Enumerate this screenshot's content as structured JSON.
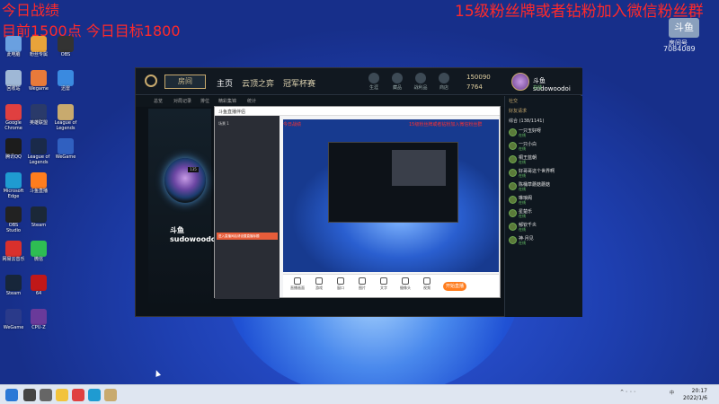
{
  "overlay": {
    "left_line1": "今日战绩",
    "left_line2": "目前1500点 今日目标1800",
    "right_banner": "15级粉丝牌或者钻粉加入微信粉丝群",
    "logo_text": "斗鱼",
    "logo_sub": "房间号",
    "room_id": "7084089"
  },
  "desktop_icons": [
    {
      "label": "此电脑",
      "color": "#6aa0e0"
    },
    {
      "label": "粉丝专属",
      "color": "#e8a33a"
    },
    {
      "label": "OBS",
      "color": "#333333"
    },
    {
      "label": "回收站",
      "color": "#9fb8d6"
    },
    {
      "label": "Wegame",
      "color": "#e87a3a"
    },
    {
      "label": "迅雷",
      "color": "#3a8ae0"
    },
    {
      "label": "Google Chrome",
      "color": "#e04040"
    },
    {
      "label": "英雄联盟",
      "color": "#2a3a6a"
    },
    {
      "label": "League of Legends",
      "color": "#c8aa6e"
    },
    {
      "label": "腾讯QQ",
      "color": "#1c1c1c"
    },
    {
      "label": "League of Legends",
      "color": "#1a2a4a"
    },
    {
      "label": "WeGame",
      "color": "#3060c0"
    },
    {
      "label": "Microsoft Edge",
      "color": "#1f9bd1"
    },
    {
      "label": "斗鱼直播",
      "color": "#ff7d1e"
    },
    {
      "label": "OBS Studio",
      "color": "#222222"
    },
    {
      "label": "Steam",
      "color": "#1b2838"
    },
    {
      "label": "网易云音乐",
      "color": "#d9302c"
    },
    {
      "label": "微信",
      "color": "#2ebd53"
    },
    {
      "label": "Steam",
      "color": "#17263a"
    },
    {
      "label": "64",
      "color": "#c01818"
    },
    {
      "label": "WeGame",
      "color": "#2a3a8a"
    },
    {
      "label": "CPU-Z",
      "color": "#6a3a9a"
    }
  ],
  "client": {
    "play_label": "房间",
    "nav": [
      "主页",
      "云顶之弈",
      "冠军杯赛"
    ],
    "header_icons": [
      "生涯",
      "藏品",
      "战利品",
      "商店"
    ],
    "blue_essence": "150090",
    "rp": "7764",
    "username": "斗鱼sudowoodoi",
    "user_status": "在线",
    "subnav": [
      "总览",
      "对局记录",
      "排位",
      "精彩集锦",
      "统计"
    ],
    "level_badge": "135",
    "summoner_name": "斗鱼sudowoodoi",
    "friends_header": "社交",
    "friends_group": "好友请求",
    "friends_sub": "综合 (138/1141)",
    "friends": [
      {
        "name": "一只玉好呀",
        "status": "在线"
      },
      {
        "name": "一只小白",
        "status": "在线"
      },
      {
        "name": "桐王蓝朝",
        "status": "在线"
      },
      {
        "name": "好哥哥这个世界啊",
        "status": "在线"
      },
      {
        "name": "陈桶草蘑菇蘑菇",
        "status": "在线"
      },
      {
        "name": "琳琅阁",
        "status": "在线"
      },
      {
        "name": "星楚乐",
        "status": "在线"
      },
      {
        "name": "郁钦千炎",
        "status": "在线"
      },
      {
        "name": "神·月见",
        "status": "在线"
      }
    ]
  },
  "stream_tool": {
    "title": "斗鱼直播伴侣",
    "scene_label": "场景 1",
    "highlight": "进入直播间后请设置直播标题",
    "preview_red_left": "今日战绩",
    "preview_red_right": "15级粉丝牌或者钻粉加入微信粉丝群",
    "bottom_buttons": [
      "直播画面",
      "游戏",
      "窗口",
      "图片",
      "文字",
      "摄像头",
      "视频"
    ],
    "start_live": "开始直播"
  },
  "taskbar": {
    "tray_lang": "中",
    "time": "20:17",
    "date": "2022/1/6"
  }
}
